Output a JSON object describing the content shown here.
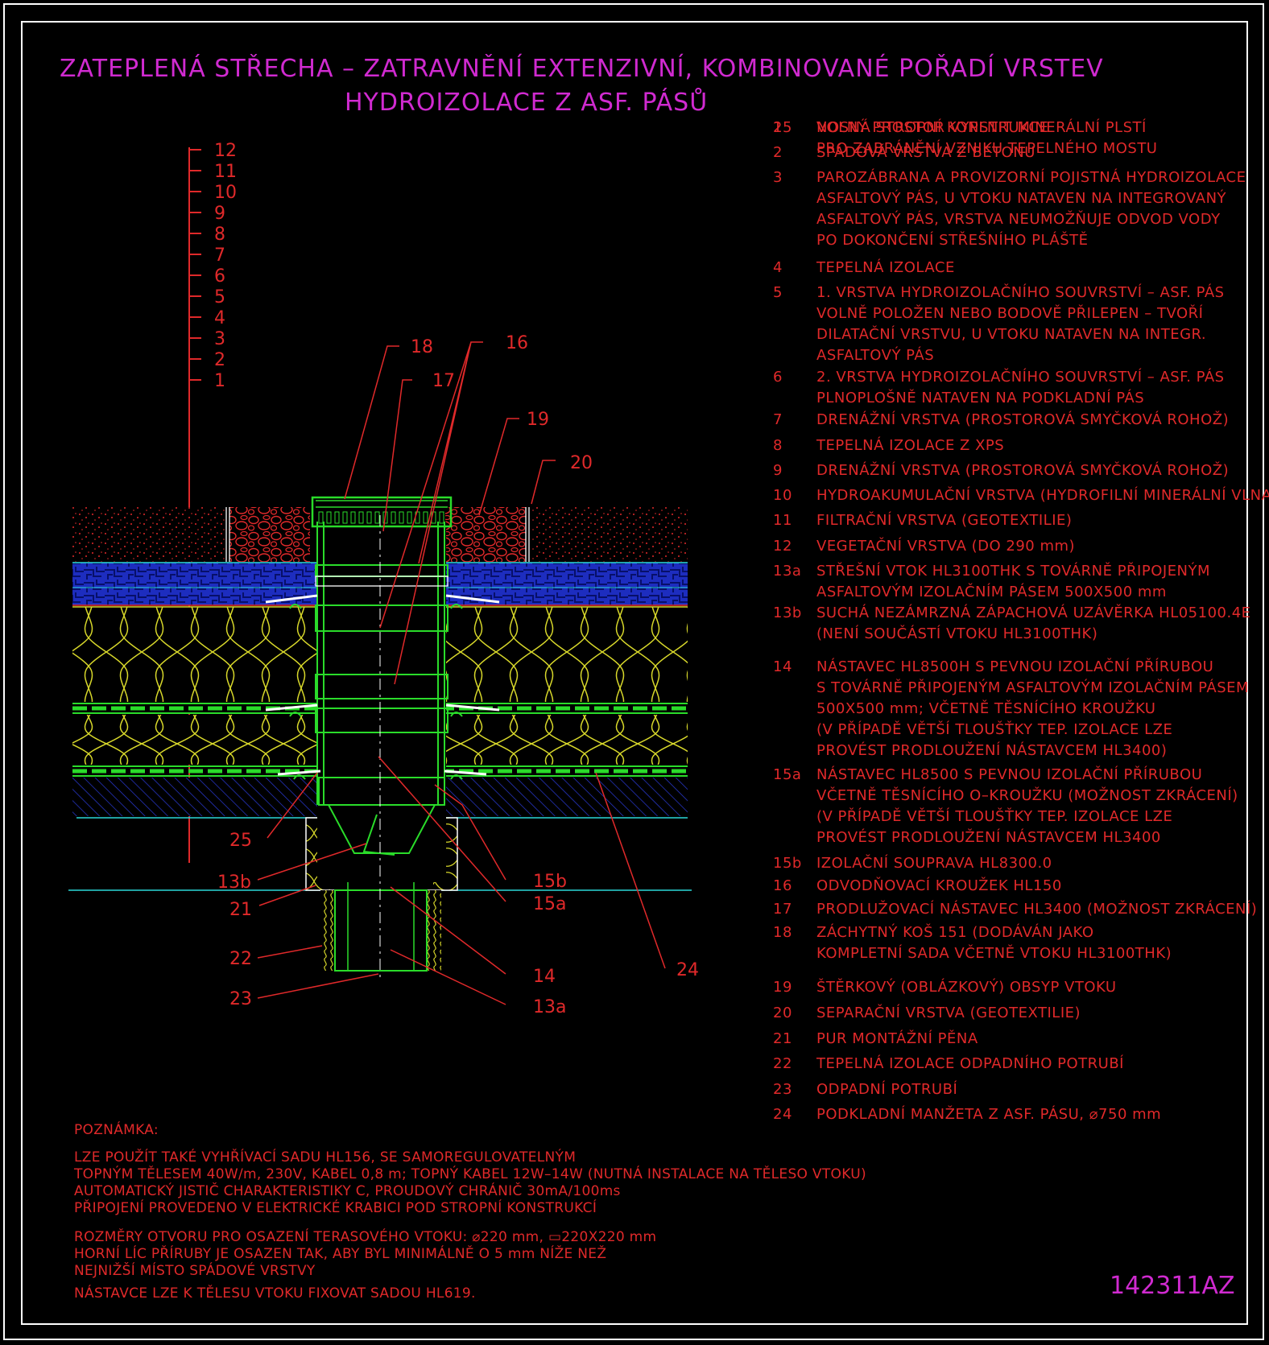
{
  "title": {
    "line1": "ZATEPLENÁ STŘECHA – ZATRAVNĚNÍ EXTENZIVNÍ, KOMBINOVANÉ POŘADÍ VRSTEV",
    "line2": "HYDROIZOLACE Z ASF. PÁSŮ"
  },
  "layer_scale": [
    "12",
    "11",
    "10",
    "9",
    "8",
    "7",
    "6",
    "5",
    "4",
    "3",
    "2",
    "1"
  ],
  "callouts": {
    "c18": "18",
    "c17": "17",
    "c16": "16",
    "c19": "19",
    "c20": "20",
    "c25": "25",
    "c13b": "13b",
    "c21": "21",
    "c22": "22",
    "c23": "23",
    "c15b": "15b",
    "c15a": "15a",
    "c14": "14",
    "c13a": "13a",
    "c24": "24"
  },
  "legend": [
    {
      "num": "1",
      "lines": [
        "NOSNÁ STROPNÍ KONSTRUKCE"
      ]
    },
    {
      "num": "2",
      "lines": [
        "SPÁDOVÁ VRSTVA Z BETONU"
      ]
    },
    {
      "num": "3",
      "lines": [
        "PAROZÁBRANA A PROVIZORNÍ POJISTNÁ HYDROIZOLACE",
        "ASFALTOVÝ PÁS, U VTOKU NATAVEN NA INTEGROVANÝ",
        "ASFALTOVÝ PÁS, VRSTVA NEUMOŽŇUJE ODVOD VODY",
        "PO DOKONČENÍ STŘEŠNÍHO PLÁŠTĚ"
      ]
    },
    {
      "num": "4",
      "lines": [
        "TEPELNÁ IZOLACE"
      ]
    },
    {
      "num": "5",
      "lines": [
        "1. VRSTVA HYDROIZOLAČNÍHO SOUVRSTVÍ – ASF. PÁS",
        "VOLNĚ POLOŽEN NEBO BODOVĚ PŘILEPEN – TVOŘÍ",
        "DILATAČNÍ VRSTVU, U VTOKU NATAVEN NA INTEGR.",
        "ASFALTOVÝ PÁS"
      ]
    },
    {
      "num": "6",
      "lines": [
        "2. VRSTVA HYDROIZOLAČNÍHO SOUVRSTVÍ – ASF. PÁS",
        "PLNOPLOŠNĚ NATAVEN NA PODKLADNÍ PÁS"
      ]
    },
    {
      "num": "7",
      "lines": [
        "DRENÁŽNÍ VRSTVA (PROSTOROVÁ SMYČKOVÁ ROHOŽ)"
      ]
    },
    {
      "num": "8",
      "lines": [
        "TEPELNÁ IZOLACE Z XPS"
      ]
    },
    {
      "num": "9",
      "lines": [
        "DRENÁŽNÍ VRSTVA (PROSTOROVÁ SMYČKOVÁ ROHOŽ)"
      ]
    },
    {
      "num": "10",
      "lines": [
        "HYDROAKUMULAČNÍ VRSTVA (HYDROFILNÍ MINERÁLNÍ VLNA)"
      ]
    },
    {
      "num": "11",
      "lines": [
        "FILTRAČNÍ VRSTVA (GEOTEXTILIE)"
      ]
    },
    {
      "num": "12",
      "lines": [
        "VEGETAČNÍ VRSTVA (DO 290 mm)"
      ]
    },
    {
      "num": "13a",
      "lines": [
        "STŘEŠNÍ VTOK HL3100THK S TOVÁRNĚ PŘIPOJENÝM",
        "ASFALTOVÝM IZOLAČNÍM PÁSEM 500X500 mm"
      ]
    },
    {
      "num": "13b",
      "lines": [
        "SUCHÁ NEZÁMRZNÁ ZÁPACHOVÁ UZÁVĚRKA HL05100.4E",
        "(NENÍ SOUČÁSTÍ VTOKU HL3100THK)"
      ]
    },
    {
      "num": "14",
      "lines": [
        "NÁSTAVEC HL8500H S PEVNOU IZOLAČNÍ PŘÍRUBOU",
        "S TOVÁRNĚ PŘIPOJENÝM ASFALTOVÝM IZOLAČNÍM PÁSEM",
        "500X500 mm; VČETNĚ TĚSNÍCÍHO KROUŽKU",
        "(V PŘÍPADĚ VĚTŠÍ TLOUŠŤKY TEP. IZOLACE LZE",
        "PROVÉST PRODLOUŽENÍ NÁSTAVCEM HL3400)"
      ]
    },
    {
      "num": "15a",
      "lines": [
        "NÁSTAVEC HL8500 S PEVNOU IZOLAČNÍ PŘÍRUBOU",
        "VČETNĚ TĚSNÍCÍHO O–KROUŽKU (MOŽNOST ZKRÁCENÍ)",
        "(V PŘÍPADĚ VĚTŠÍ TLOUŠŤKY TEP. IZOLACE LZE",
        "PROVÉST PRODLOUŽENÍ NÁSTAVCEM HL3400"
      ]
    },
    {
      "num": "15b",
      "lines": [
        "IZOLAČNÍ SOUPRAVA HL8300.0"
      ]
    },
    {
      "num": "16",
      "lines": [
        "ODVODŇOVACÍ KROUŽEK HL150"
      ]
    },
    {
      "num": "17",
      "lines": [
        "PRODLUŽOVACÍ NÁSTAVEC HL3400 (MOŽNOST ZKRÁCENÍ)"
      ]
    },
    {
      "num": "18",
      "lines": [
        "ZÁCHYTNÝ KOŠ 151 (DODÁVÁN JAKO",
        "KOMPLETNÍ SADA VČETNĚ VTOKU HL3100THK)"
      ]
    },
    {
      "num": "19",
      "lines": [
        "ŠTĚRKOVÝ (OBLÁZKOVÝ) OBSYP VTOKU"
      ]
    },
    {
      "num": "20",
      "lines": [
        "SEPARAČNÍ VRSTVA (GEOTEXTILIE)"
      ]
    },
    {
      "num": "21",
      "lines": [
        "PUR MONTÁŽNÍ PĚNA"
      ]
    },
    {
      "num": "22",
      "lines": [
        "TEPELNÁ IZOLACE ODPADNÍHO POTRUBÍ"
      ]
    },
    {
      "num": "23",
      "lines": [
        "ODPADNÍ POTRUBÍ"
      ]
    },
    {
      "num": "24",
      "lines": [
        "PODKLADNÍ MANŽETA Z ASF. PÁSU, ⌀750 mm"
      ]
    },
    {
      "num": "25",
      "lines": [
        "VOLNÝ PROSTOR VYPLNIT MINERÁLNÍ PLSTÍ",
        "PRO ZABRÁNĚNÍ VZNIKU TEPELNÉHO MOSTU"
      ]
    }
  ],
  "notes": {
    "heading": "POZNÁMKA:",
    "block1": [
      "LZE POUŽÍT TAKÉ VYHŘÍVACÍ SADU HL156, SE SAMOREGULOVATELNÝM",
      "TOPNÝM TĚLESEM 40W/m, 230V, KABEL 0,8 m; TOPNÝ KABEL 12W–14W (NUTNÁ INSTALACE NA TĚLESO VTOKU)",
      "AUTOMATICKÝ JISTIČ CHARAKTERISTIKY C, PROUDOVÝ CHRÁNIČ 30mA/100ms",
      "PŘIPOJENÍ PROVEDENO V ELEKTRICKÉ KRABICI POD STROPNÍ KONSTRUKCÍ"
    ],
    "block2": [
      "ROZMĚRY OTVORU PRO OSAZENÍ TERASOVÉHO VTOKU: ⌀220 mm, ▭220X220 mm",
      "HORNÍ LÍC PŘÍRUBY JE OSAZEN TAK, ABY BYL MINIMÁLNĚ O 5 mm NÍŽE NEŽ",
      "NEJNIŽŠÍ MÍSTO SPÁDOVÉ VRSTVY"
    ],
    "block3": "NÁSTAVCE LZE K TĚLESU VTOKU FIXOVAT SADOU HL619."
  },
  "drawing_code": "142311AZ",
  "colors": {
    "red": "#e0292a",
    "magenta": "#d02ad0",
    "yellow": "#d8d82a",
    "green": "#2adc2a",
    "blue": "#2a3ad8",
    "cyan": "#2ad8d8",
    "white": "#ffffff"
  }
}
